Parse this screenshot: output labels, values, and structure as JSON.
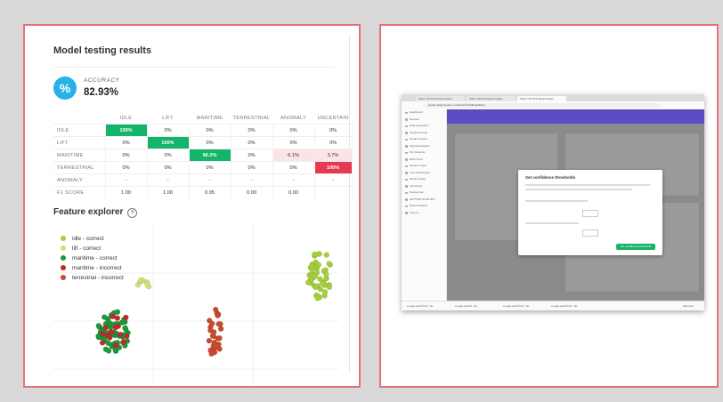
{
  "left_panel": {
    "title": "Model testing results",
    "accuracy": {
      "icon": "percent-icon",
      "icon_glyph": "%",
      "label": "ACCURACY",
      "value": "82.93%"
    },
    "matrix": {
      "columns": [
        "IDLE",
        "LIFT",
        "MARITIME",
        "TERRESTRIAL",
        "ANOMALY",
        "UNCERTAIN"
      ],
      "rows": [
        {
          "label": "IDLE",
          "cells": [
            "100%",
            "0%",
            "0%",
            "0%",
            "0%",
            "0%"
          ]
        },
        {
          "label": "LIFT",
          "cells": [
            "0%",
            "100%",
            "0%",
            "0%",
            "0%",
            "0%"
          ]
        },
        {
          "label": "MARITIME",
          "cells": [
            "0%",
            "0%",
            "90.2%",
            "0%",
            "6.1%",
            "3.7%"
          ]
        },
        {
          "label": "TERRESTRIAL",
          "cells": [
            "0%",
            "0%",
            "0%",
            "0%",
            "0%",
            "100%"
          ]
        },
        {
          "label": "ANOMALY",
          "cells": [
            "-",
            "-",
            "-",
            "-",
            "-",
            "-"
          ]
        },
        {
          "label": "F1 SCORE",
          "cells": [
            "1.00",
            "1.00",
            "0.95",
            "0.00",
            "0.00",
            ""
          ]
        }
      ]
    },
    "feature_explorer": {
      "title": "Feature explorer",
      "help_icon": "help-circle-icon",
      "legend": [
        {
          "label": "idle - correct",
          "color": "#a6cf3c"
        },
        {
          "label": "lift - correct",
          "color": "#cde27a"
        },
        {
          "label": "maritime - correct",
          "color": "#1c9a3a"
        },
        {
          "label": "maritime - incorrect",
          "color": "#c02a28"
        },
        {
          "label": "terrestrial - incorrect",
          "color": "#c94a2e"
        }
      ]
    }
  },
  "right_panel": {
    "browser": {
      "tabs": [
        "SIGA YOLOv5 Model Classi...",
        "SIGA YOLOv5 Model Classi...",
        "SIGA YOLOv5 Model Classi..."
      ],
      "url": "studio.edgeimpulse.com/studio/12345/validation",
      "sidebar_items": [
        "Dashboard",
        "Devices",
        "Data acquisition",
        "Impulse design",
        "Create impulse",
        "Spectral features",
        "NN Classifier",
        "EON Tuner",
        "Retrain model",
        "Live classification",
        "Model testing",
        "Versioning",
        "Deployment",
        "GETTING STARTED",
        "Documentation",
        "Forums"
      ],
      "modal_title": "Set confidence thresholds",
      "modal_button": "Set confidence thresholds",
      "downloads": [
        "ei-siga-yolov5 (1)...zip",
        "ei-siga-yolov5...zip",
        "ei-siga-yolov5 (2)...zip",
        "ei-siga-yolov5 (3)...zip"
      ],
      "show_all": "Show All"
    }
  }
}
